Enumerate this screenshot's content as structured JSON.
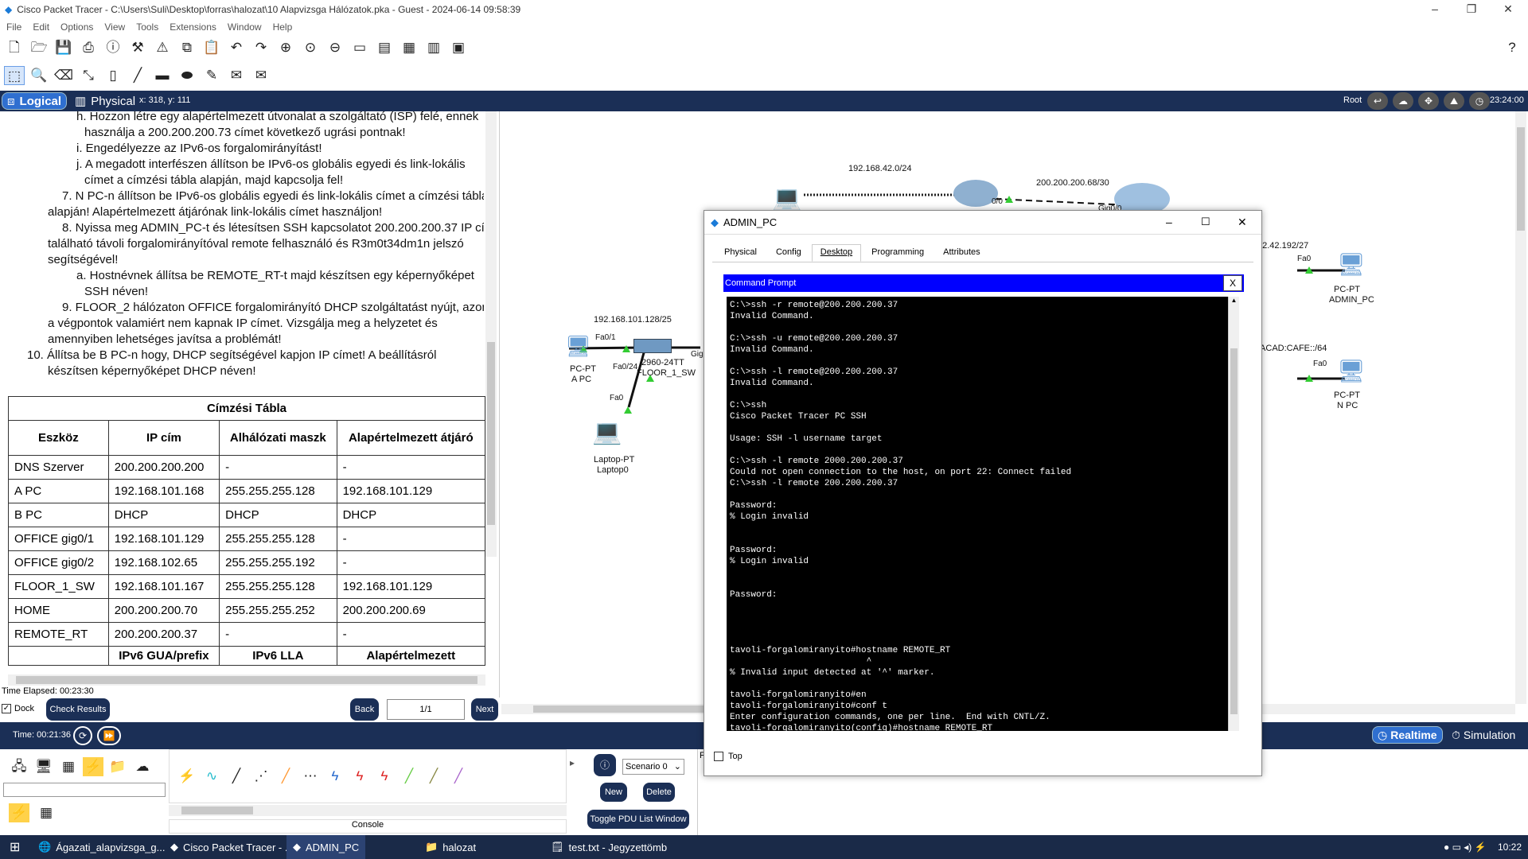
{
  "window": {
    "title": "Cisco Packet Tracer - C:\\Users\\Suli\\Desktop\\forras\\halozat\\10 Alapvizsga Hálózatok.pka - Guest - 2024-06-14 09:58:39"
  },
  "menu": [
    "File",
    "Edit",
    "Options",
    "View",
    "Tools",
    "Extensions",
    "Window",
    "Help"
  ],
  "mode_bar": {
    "logical": "Logical",
    "physical": "Physical",
    "coords": "x: 318, y: 111",
    "root": "Root",
    "clock": "23:24:00"
  },
  "instructions": [
    {
      "text": "h. Hozzon létre egy alapértelmezett útvonalat a szolgáltató (ISP) felé, ennek",
      "indent": 2
    },
    {
      "text": "használja a 200.200.200.73 címet következő ugrási pontnak!",
      "indent": 3
    },
    {
      "text": "i. Engedélyezze az IPv6-os forgalomirányítást!",
      "indent": 2
    },
    {
      "text": "j. A megadott interfészen állítson be IPv6-os globális egyedi és link-lokális",
      "indent": 2
    },
    {
      "text": "címet a címzési tábla alapján, majd kapcsolja fel!",
      "indent": 3
    },
    {
      "text": "7. N PC-n állítson be IPv6-os globális egyedi és link-lokális címet a címzési tábla",
      "indent": 1
    },
    {
      "text": "alapján! Alapértelmezett átjárónak link-lokális címet használjon!",
      "indent": 0
    },
    {
      "text": "8. Nyissa meg ADMIN_PC-t és létesítsen SSH kapcsolatot 200.200.200.37 IP címen",
      "indent": 1
    },
    {
      "text": "található távoli forgalomirányítóval remote felhasználó és R3m0t34dm1n jelszó",
      "indent": 0
    },
    {
      "text": "segítségével!",
      "indent": 0
    },
    {
      "text": "a. Hostnévnek állítsa be REMOTE_RT-t majd készítsen egy képernyőképet",
      "indent": 2
    },
    {
      "text": "SSH néven!",
      "indent": 3
    },
    {
      "text": "9. FLOOR_2 hálózaton OFFICE forgalomirányító DHCP szolgáltatást nyújt, azonban",
      "indent": 1
    },
    {
      "text": "a végpontok valamiért nem kapnak IP címet. Vizsgálja meg a helyzetet és",
      "indent": 0
    },
    {
      "text": "amennyiben lehetséges javítsa a problémát!",
      "indent": 0
    },
    {
      "text": "10. Állítsa be B PC-n hogy, DHCP segítségével kapjon IP címet! A beállításról",
      "indent": 1
    },
    {
      "text": "készítsen képernyőképet DHCP néven!",
      "indent": 0
    }
  ],
  "address_table": {
    "title": "Címzési Tábla",
    "headers": [
      "Eszköz",
      "IP cím",
      "Alhálózati maszk",
      "Alapértelmezett átjáró"
    ],
    "rows": [
      [
        "DNS Szerver",
        "200.200.200.200",
        "-",
        "-"
      ],
      [
        "A PC",
        "192.168.101.168",
        "255.255.255.128",
        "192.168.101.129"
      ],
      [
        "B PC",
        "DHCP",
        "DHCP",
        "DHCP"
      ],
      [
        "OFFICE gig0/1",
        "192.168.101.129",
        "255.255.255.128",
        "-"
      ],
      [
        "OFFICE gig0/2",
        "192.168.102.65",
        "255.255.255.192",
        "-"
      ],
      [
        "FLOOR_1_SW",
        "192.168.101.167",
        "255.255.255.128",
        "192.168.101.129"
      ],
      [
        "HOME",
        "200.200.200.70",
        "255.255.255.252",
        "200.200.200.69"
      ],
      [
        "REMOTE_RT",
        "200.200.200.37",
        "-",
        "-"
      ]
    ],
    "ipv6_headers": [
      "",
      "IPv6 GUA/prefix",
      "IPv6 LLA",
      "Alapértelmezett"
    ]
  },
  "left_footer": {
    "time_elapsed": "Time Elapsed: 00:23:30",
    "dock": "Dock",
    "check": "Check Results",
    "back": "Back",
    "page": "1/1",
    "next": "Next"
  },
  "topology": {
    "labels": [
      "192.168.42.0/24",
      "200.200.200.68/30",
      "0/0",
      "Gig0/0",
      "192.168.101.128/25",
      "Fa0/1",
      "Fa0/24",
      "Fa0",
      "Gig",
      "2960-24TT",
      "FLOOR_1_SW",
      "Laptop-PT",
      "Laptop0",
      "PC-PT",
      "A PC",
      "42.42.192/27",
      "Fa0",
      "PC-PT",
      "ADMIN_PC",
      ":ACAD:CAFE::/64",
      "Fa0",
      "PC-PT",
      "N PC"
    ]
  },
  "dialog": {
    "title": "ADMIN_PC",
    "tabs": [
      "Physical",
      "Config",
      "Desktop",
      "Programming",
      "Attributes"
    ],
    "active_tab": "Desktop",
    "cmd_title": "Command Prompt",
    "cmd_close": "X",
    "top_label": "Top",
    "terminal": "C:\\>ssh -r remote@200.200.200.37\nInvalid Command.\n\nC:\\>ssh -u remote@200.200.200.37\nInvalid Command.\n\nC:\\>ssh -l remote@200.200.200.37\nInvalid Command.\n\nC:\\>ssh\nCisco Packet Tracer PC SSH\n\nUsage: SSH -l username target\n\nC:\\>ssh -l remote 2000.200.200.37\nCould not open connection to the host, on port 22: Connect failed\nC:\\>ssh -l remote 200.200.200.37\n\nPassword:\n% Login invalid\n\n\nPassword:\n% Login invalid\n\n\nPassword:\n\n\n\n\ntavoli-forgalomiranyito#hostname REMOTE_RT\n                          ^\n% Invalid input detected at '^' marker.\n\ntavoli-forgalomiranyito#en\ntavoli-forgalomiranyito#conf t\nEnter configuration commands, one per line.  End with CNTL/Z.\ntavoli-forgalomiranyito(config)#hostname REMOTE_RT\nREMOTE_RT(config)#"
  },
  "bottom": {
    "time": "Time: 00:21:36",
    "realtime": "Realtime",
    "simulation": "Simulation",
    "scenario": "Scenario 0",
    "new": "New",
    "delete": "Delete",
    "toggle_pdu": "Toggle PDU List Window",
    "console": "Console",
    "f_label": "F"
  },
  "taskbar": {
    "items": [
      "Ágazati_alapvizsga_g...",
      "Cisco Packet Tracer - ...",
      "ADMIN_PC",
      "halozat",
      "test.txt - Jegyzettömb"
    ],
    "clock": "10:22"
  },
  "colors": {
    "navy": "#1b2f56",
    "cmd_blue": "#0000ff",
    "terminal_bg": "#000000",
    "taskbar": "#1a2a48"
  }
}
